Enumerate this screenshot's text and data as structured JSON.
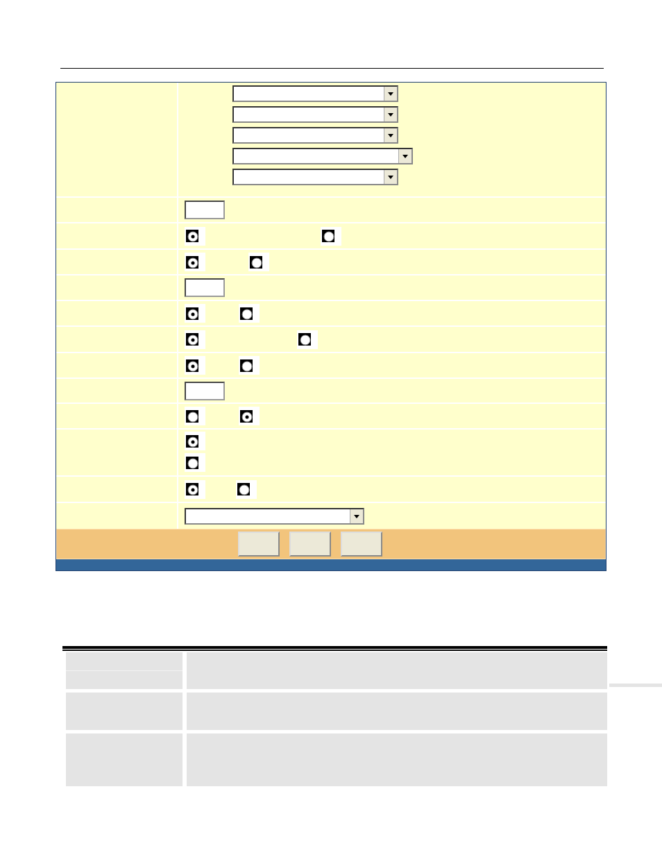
{
  "form": {
    "rows": [
      {
        "kind": "selects",
        "selects": [
          {
            "wide": false
          },
          {
            "wide": false
          },
          {
            "wide": false
          },
          {
            "wide": true
          },
          {
            "wide": false
          }
        ]
      },
      {
        "kind": "text"
      },
      {
        "kind": "radios",
        "options": [
          {
            "selected": true
          },
          {
            "selected": false
          }
        ]
      },
      {
        "kind": "radios",
        "options": [
          {
            "selected": true
          },
          {
            "selected": false
          }
        ]
      },
      {
        "kind": "text"
      },
      {
        "kind": "radios",
        "options": [
          {
            "selected": true
          },
          {
            "selected": false
          }
        ]
      },
      {
        "kind": "radios",
        "options": [
          {
            "selected": true
          },
          {
            "selected": false
          }
        ]
      },
      {
        "kind": "radios",
        "options": [
          {
            "selected": true
          },
          {
            "selected": false
          }
        ]
      },
      {
        "kind": "text"
      },
      {
        "kind": "radios",
        "options": [
          {
            "selected": false
          },
          {
            "selected": true
          }
        ]
      },
      {
        "kind": "radio_stack",
        "options": [
          {
            "selected": true
          },
          {
            "selected": false
          }
        ]
      },
      {
        "kind": "radios",
        "options": [
          {
            "selected": true
          },
          {
            "selected": false
          }
        ]
      },
      {
        "kind": "select"
      }
    ],
    "buttons": [
      {
        "kind": "button"
      },
      {
        "kind": "button"
      },
      {
        "kind": "button"
      }
    ]
  },
  "info_table": {
    "rows": [
      {
        "kind": "split"
      },
      {
        "kind": "plain"
      },
      {
        "kind": "tall"
      }
    ]
  }
}
